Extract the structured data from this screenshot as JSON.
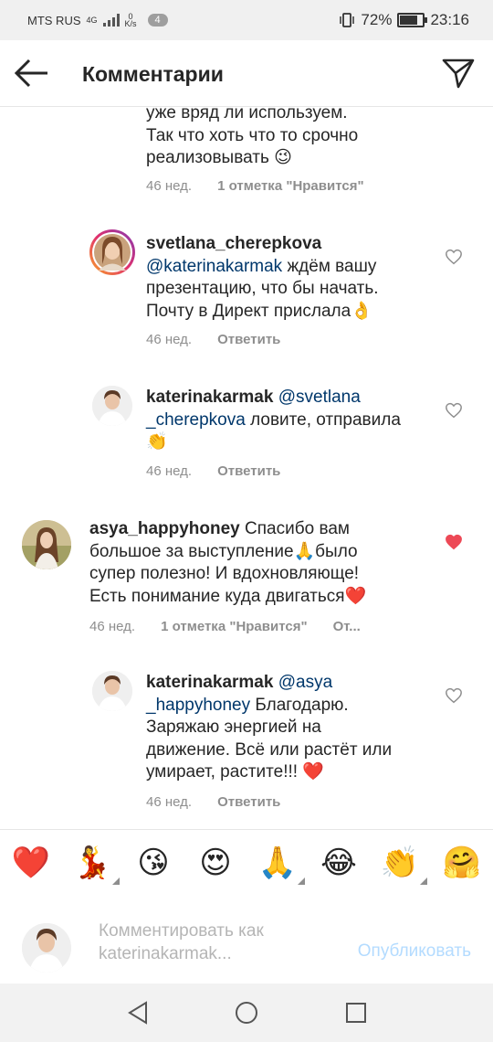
{
  "status_bar": {
    "carrier": "MTS RUS",
    "network": "4G",
    "speed_value": "0",
    "speed_unit": "K/s",
    "notification_count": "4",
    "battery": "72%",
    "battery_level": 0.72,
    "time": "23:16"
  },
  "header": {
    "title": "Комментарии"
  },
  "comments": [
    {
      "text_lines": [
        "уже вряд ли используем.",
        "Так что хоть что то срочно",
        "реализовывать 😉"
      ],
      "time": "46 нед.",
      "likes": "1 отметка \"Нравится\""
    },
    {
      "username": "svetlana_cherepkova",
      "mention": "@katerinakarmak",
      "text_line1": " ждём вашу",
      "text_lines": [
        "презентацию, что бы начать.",
        "Почту в Директ прислала👌"
      ],
      "time": "46 нед.",
      "reply": "Ответить"
    },
    {
      "username": "katerinakarmak",
      "mention1": "@svetlana",
      "mention2": "_cherepkova",
      "text_line2": " ловите, отправила",
      "text_line3": "👏",
      "time": "46 нед.",
      "reply": "Ответить"
    },
    {
      "username": "asya_happyhoney",
      "text_line1": " Спасибо вам",
      "text_lines": [
        "большое за выступление🙏было",
        "супер полезно! И вдохновляюще!",
        "Есть понимание куда двигаться❤️"
      ],
      "time": "46 нед.",
      "likes": "1 отметка \"Нравится\"",
      "reply_truncated": "От..."
    },
    {
      "username": "katerinakarmak",
      "mention1": "@asya",
      "mention2": "_happyhoney",
      "text_line2": " Благодарю.",
      "text_lines": [
        "Заряжаю энергией на",
        "движение. Всё или растёт или",
        "умирает, растите!!! ❤️"
      ],
      "time": "46 нед.",
      "reply": "Ответить"
    }
  ],
  "emoji_bar": [
    "❤️",
    "💃",
    "😘",
    "😍",
    "🙏",
    "😂",
    "👏",
    "🤗"
  ],
  "compose": {
    "placeholder": "Комментировать как katerinakarmak...",
    "post_label": "Опубликовать"
  },
  "colors": {
    "liked_heart": "#ed4956",
    "mention": "#00376b",
    "post_disabled": "#b3dbff"
  }
}
